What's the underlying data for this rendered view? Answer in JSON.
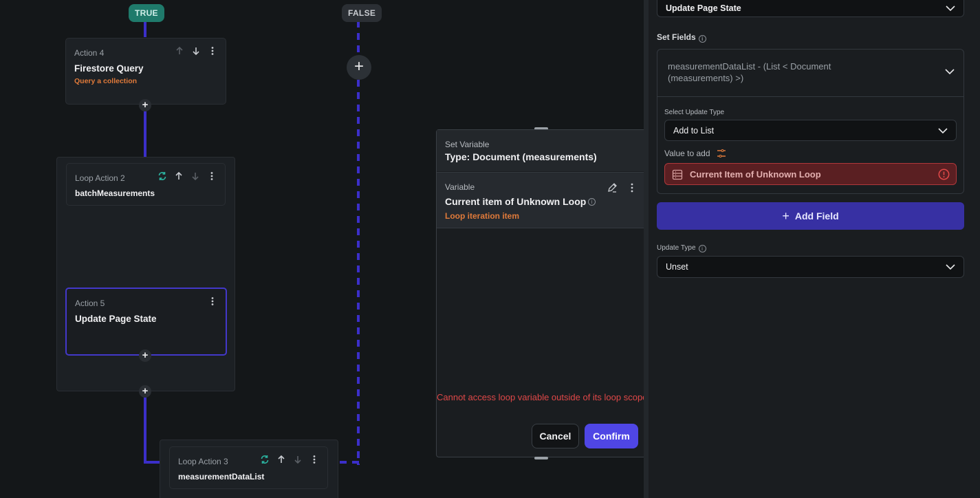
{
  "flow": {
    "branch_true": "TRUE",
    "branch_false": "FALSE",
    "action4": {
      "label": "Action 4",
      "title": "Firestore Query",
      "subtitle": "Query a collection"
    },
    "loop2": {
      "label": "Loop Action 2",
      "title": "batchMeasurements"
    },
    "action5": {
      "label": "Action 5",
      "title": "Update Page State"
    },
    "loop3": {
      "label": "Loop Action 3",
      "title": "measurementDataList"
    },
    "add_symbol": "+"
  },
  "modal": {
    "header_kicker": "Set Variable",
    "header_type": "Type: Document (measurements)",
    "variable_kicker": "Variable",
    "variable_name": "Current item of Unknown Loop",
    "variable_source": "Loop iteration item",
    "error": "Cannot access loop variable outside of its loop scope",
    "cancel": "Cancel",
    "confirm": "Confirm"
  },
  "panel": {
    "action_select": "Update Page State",
    "set_fields_label": "Set Fields",
    "field_name": "measurementDataList - (List < Document (measurements) >)",
    "select_update_type_label": "Select Update Type",
    "update_type_value": "Add to List",
    "value_to_add_label": "Value to add",
    "value_to_add": "Current Item of Unknown Loop",
    "add_field": "Add Field",
    "update_type_label": "Update Type",
    "update_type_select": "Unset"
  },
  "colors": {
    "accent": "#4f46e5",
    "connector": "#3b2fc9",
    "error": "#e04848",
    "subtitle": "#e07a3a",
    "true_pill": "#1f7a6b"
  }
}
